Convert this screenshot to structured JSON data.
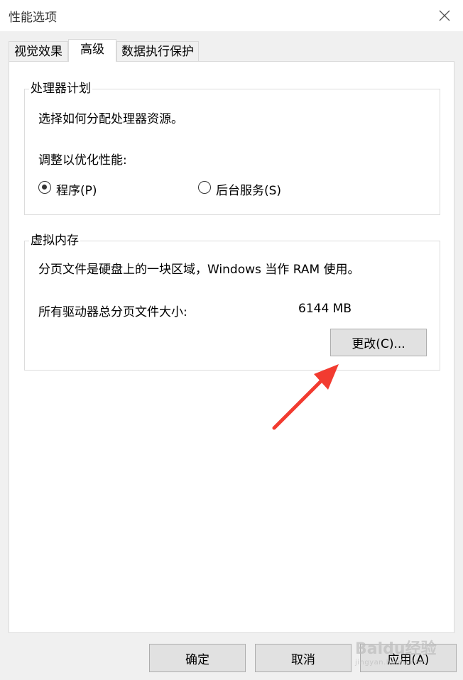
{
  "window": {
    "title": "性能选项"
  },
  "tabs": [
    {
      "label": "视觉效果"
    },
    {
      "label": "高级"
    },
    {
      "label": "数据执行保护"
    }
  ],
  "processor": {
    "legend": "处理器计划",
    "description": "选择如何分配处理器资源。",
    "adjust_label": "调整以优化性能:",
    "option_programs": "程序(P)",
    "option_background": "后台服务(S)",
    "selected": "程序(P)"
  },
  "virtual_memory": {
    "legend": "虚拟内存",
    "description": "分页文件是硬盘上的一块区域，Windows 当作 RAM 使用。",
    "total_label": "所有驱动器总分页文件大小:",
    "total_value": "6144 MB",
    "change_button": "更改(C)..."
  },
  "footer": {
    "ok": "确定",
    "cancel": "取消",
    "apply": "应用(A)"
  },
  "watermark": {
    "brand": "Baidu经验",
    "url": "jingyan.baidu.com"
  },
  "colors": {
    "arrow": "#f23b30"
  }
}
